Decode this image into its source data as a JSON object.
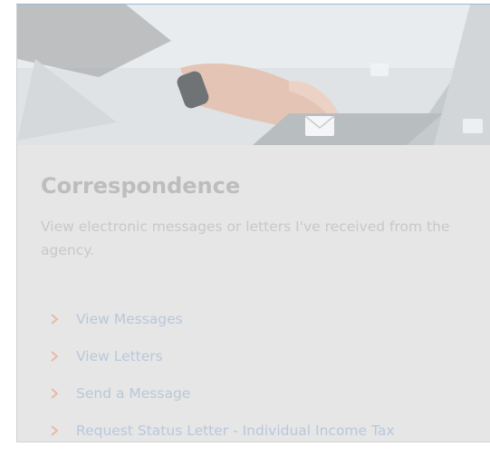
{
  "card": {
    "title": "Correspondence",
    "description": "View electronic messages or letters I've received from the agency.",
    "links": [
      {
        "label": "View Messages"
      },
      {
        "label": "View Letters"
      },
      {
        "label": "Send a Message"
      },
      {
        "label": "Request Status Letter - Individual Income Tax"
      }
    ]
  },
  "colors": {
    "card_background": "#e6e6e6",
    "title": "#bdbdbd",
    "description": "#c8c8c8",
    "link": "#b8c8da",
    "chevron": "#e8b7a2",
    "accent_line": "#9ab8d3"
  },
  "icons": {
    "link_bullet": "chevron-right-icon",
    "hero_overlay": "envelope-icon"
  }
}
